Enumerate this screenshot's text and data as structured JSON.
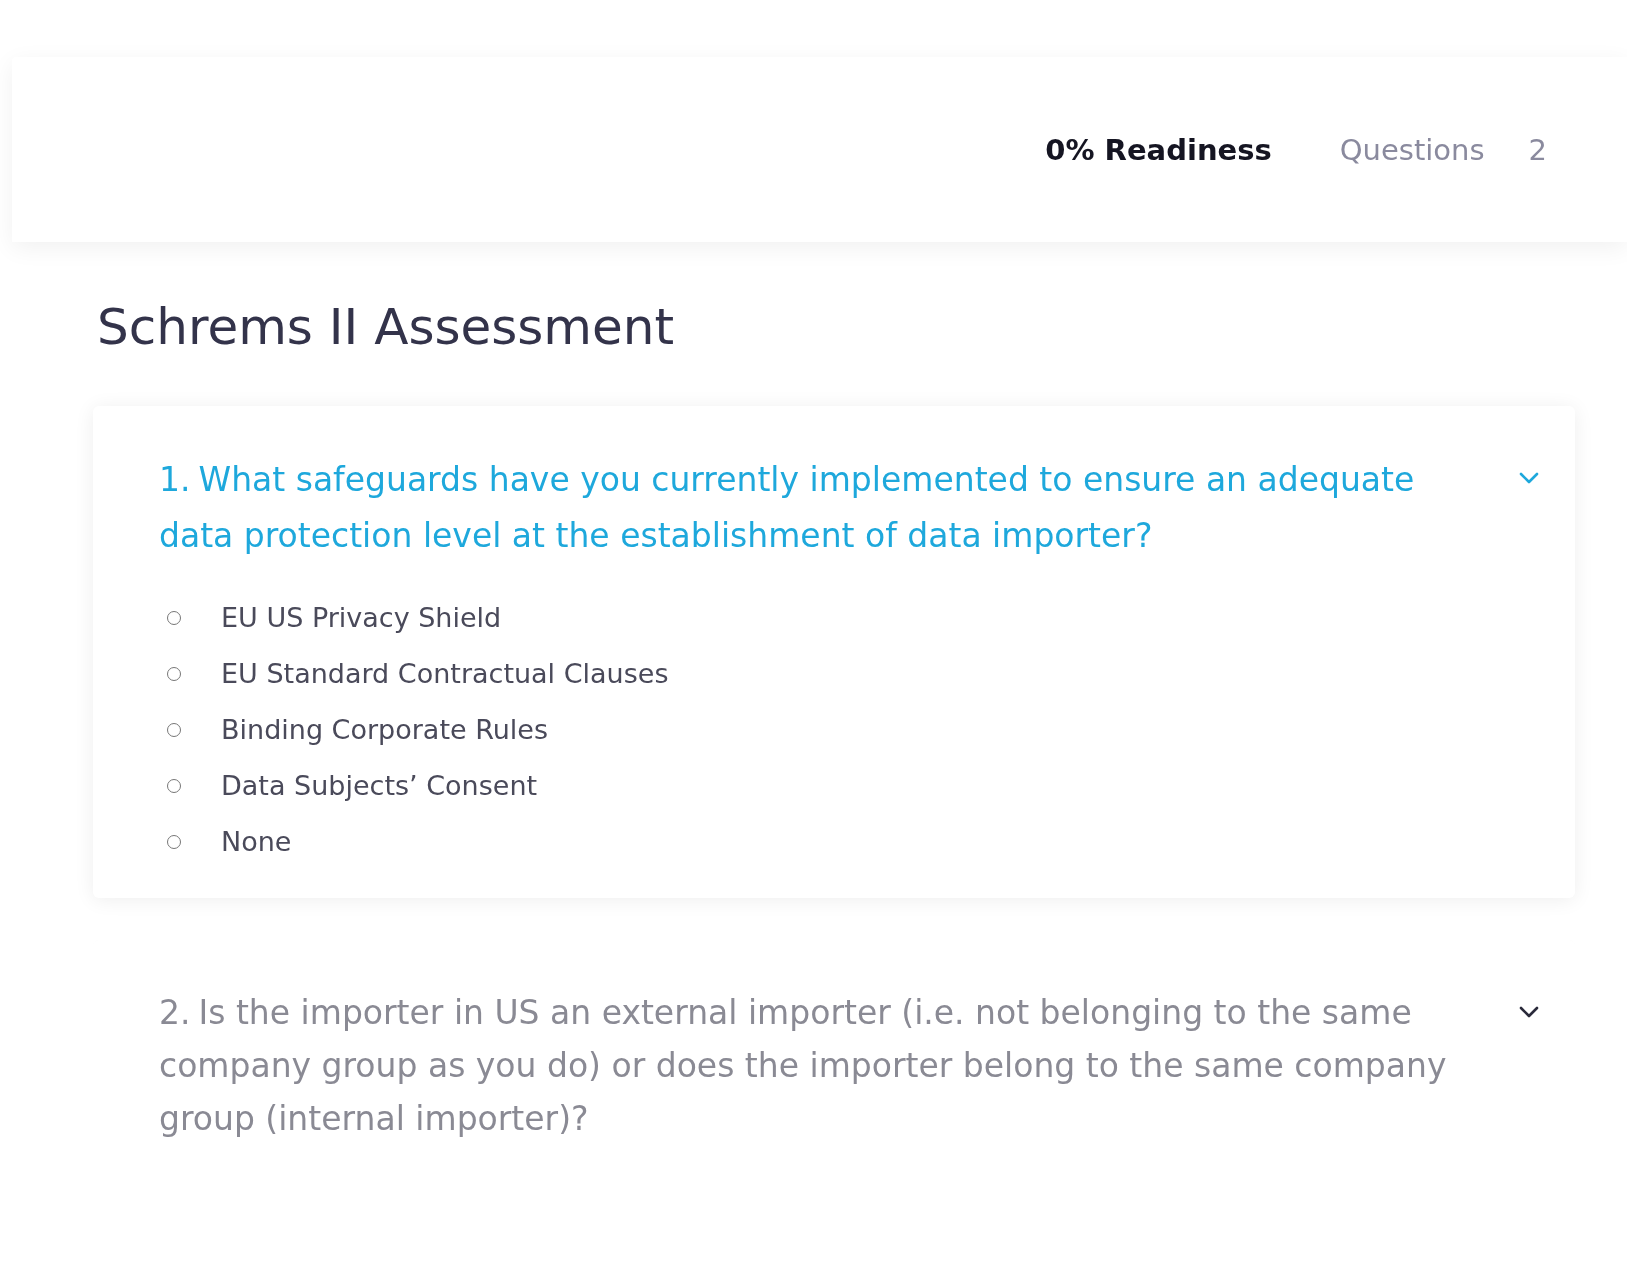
{
  "header": {
    "readiness": "0% Readiness",
    "questions_label": "Questions",
    "questions_count": "2"
  },
  "title": "Schrems II Assessment",
  "questions": [
    {
      "number": "1.",
      "text": "What safeguards have you currently implemented to ensure an adequate data protection level at the establishment of data importer?",
      "expanded": true,
      "options": [
        {
          "label": "EU US Privacy Shield",
          "selected": false
        },
        {
          "label": "EU Standard Contractual Clauses",
          "selected": false
        },
        {
          "label": "Binding Corporate Rules",
          "selected": false
        },
        {
          "label": "Data Subjects’ Consent",
          "selected": false
        },
        {
          "label": "None",
          "selected": false
        }
      ]
    },
    {
      "number": "2.",
      "text": "Is the importer in US an external importer (i.e. not belonging to the same company group as you do) or does the importer belong to the same company group (internal importer)?",
      "expanded": false
    }
  ]
}
